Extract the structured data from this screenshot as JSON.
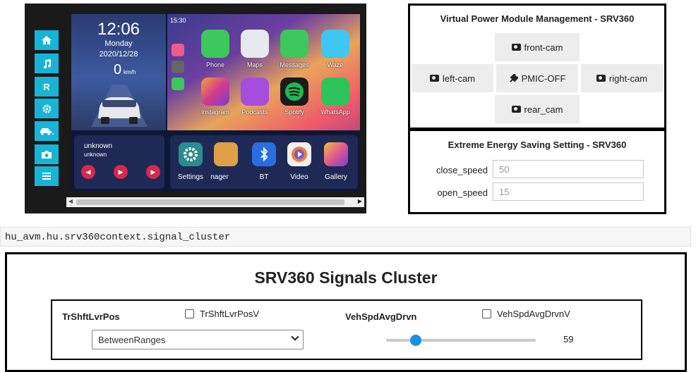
{
  "head_unit": {
    "nav_buttons": [
      {
        "icon": "home-icon",
        "label": ""
      },
      {
        "icon": "music-icon",
        "label": ""
      },
      {
        "icon": "r-icon",
        "label": "R"
      },
      {
        "icon": "gear-icon",
        "label": ""
      },
      {
        "icon": "car-icon",
        "label": ""
      },
      {
        "icon": "camera-icon",
        "label": ""
      },
      {
        "icon": "menu-icon",
        "label": ""
      }
    ],
    "time": "12:06",
    "day": "Monday",
    "date": "2020/12/28",
    "speed": "0",
    "speed_unit": "km/h",
    "status_time": "15:30",
    "apps": [
      {
        "label": "Phone",
        "color": "#3cc85a"
      },
      {
        "label": "Maps",
        "color": "#e8e8f0"
      },
      {
        "label": "Messages",
        "color": "#3cc85a"
      },
      {
        "label": "Waze",
        "color": "#3ec7f0"
      },
      {
        "label": "Instagram",
        "color": "#d23c8c"
      },
      {
        "label": "Podcasts",
        "color": "#a64de0"
      },
      {
        "label": "Spotify",
        "color": "#1b1b1b"
      },
      {
        "label": "WhatsApp",
        "color": "#2fc35c"
      }
    ],
    "media": {
      "title": "unknown",
      "subtitle": "unknown"
    },
    "dock": [
      {
        "label": "Settings",
        "color": "#2a8c8c"
      },
      {
        "label": "nager",
        "color": "#e0a048"
      },
      {
        "label": "BT",
        "color": "#2a6de0"
      },
      {
        "label": "Video",
        "color": "#f0f0f0"
      },
      {
        "label": "Gallery",
        "color": "#e07aa0"
      }
    ]
  },
  "power_module": {
    "title": "Virtual Power Module Management - SRV360",
    "front_cam": "front-cam",
    "left_cam": "left-cam",
    "pmic_off": "PMIC-OFF",
    "right_cam": "right-cam",
    "rear_cam": "rear_cam"
  },
  "energy": {
    "title": "Extreme Energy Saving Setting - SRV360",
    "close_speed_label": "close_speed",
    "close_speed_placeholder": "50",
    "open_speed_label": "open_speed",
    "open_speed_placeholder": "15"
  },
  "context_path": "hu_avm.hu.srv360context.signal_cluster",
  "cluster": {
    "title": "SRV360 Signals Cluster",
    "shift_name": "TrShftLvrPos",
    "shift_valid_label": "TrShftLvrPosV",
    "shift_value": "BetweenRanges",
    "speed_name": "VehSpdAvgDrvn",
    "speed_valid_label": "VehSpdAvgDrvnV",
    "speed_value": "59",
    "speed_fraction": 0.2
  }
}
